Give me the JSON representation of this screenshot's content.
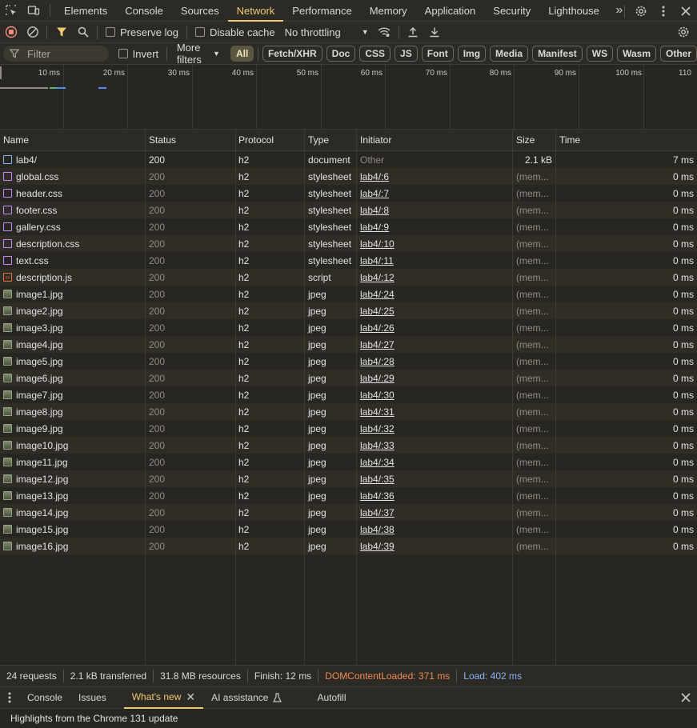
{
  "main_tabs": [
    "Elements",
    "Console",
    "Sources",
    "Network",
    "Performance",
    "Memory",
    "Application",
    "Security",
    "Lighthouse"
  ],
  "active_tab": "Network",
  "toolbar": {
    "preserve_log": "Preserve log",
    "disable_cache": "Disable cache",
    "throttling": "No throttling"
  },
  "filter": {
    "placeholder": "Filter",
    "invert": "Invert",
    "more_filters": "More filters",
    "chips": [
      "All",
      "Fetch/XHR",
      "Doc",
      "CSS",
      "JS",
      "Font",
      "Img",
      "Media",
      "Manifest",
      "WS",
      "Wasm",
      "Other"
    ],
    "active_chip": "All"
  },
  "overview": {
    "ticks": [
      "10 ms",
      "20 ms",
      "30 ms",
      "40 ms",
      "50 ms",
      "60 ms",
      "70 ms",
      "80 ms",
      "90 ms",
      "100 ms",
      "110"
    ]
  },
  "columns": [
    "Name",
    "Status",
    "Protocol",
    "Type",
    "Initiator",
    "Size",
    "Time"
  ],
  "rows": [
    {
      "name": "lab4/",
      "icon": "doc",
      "status": "200",
      "protocol": "h2",
      "type": "document",
      "initiator": "Other",
      "size": "2.1 kB",
      "time": "7 ms"
    },
    {
      "name": "global.css",
      "icon": "css",
      "status": "200",
      "protocol": "h2",
      "type": "stylesheet",
      "initiator": "lab4/:6",
      "size": "(mem...",
      "time": "0 ms"
    },
    {
      "name": "header.css",
      "icon": "css",
      "status": "200",
      "protocol": "h2",
      "type": "stylesheet",
      "initiator": "lab4/:7",
      "size": "(mem...",
      "time": "0 ms"
    },
    {
      "name": "footer.css",
      "icon": "css",
      "status": "200",
      "protocol": "h2",
      "type": "stylesheet",
      "initiator": "lab4/:8",
      "size": "(mem...",
      "time": "0 ms"
    },
    {
      "name": "gallery.css",
      "icon": "css",
      "status": "200",
      "protocol": "h2",
      "type": "stylesheet",
      "initiator": "lab4/:9",
      "size": "(mem...",
      "time": "0 ms"
    },
    {
      "name": "description.css",
      "icon": "css",
      "status": "200",
      "protocol": "h2",
      "type": "stylesheet",
      "initiator": "lab4/:10",
      "size": "(mem...",
      "time": "0 ms"
    },
    {
      "name": "text.css",
      "icon": "css",
      "status": "200",
      "protocol": "h2",
      "type": "stylesheet",
      "initiator": "lab4/:11",
      "size": "(mem...",
      "time": "0 ms"
    },
    {
      "name": "description.js",
      "icon": "js",
      "status": "200",
      "protocol": "h2",
      "type": "script",
      "initiator": "lab4/:12",
      "size": "(mem...",
      "time": "0 ms"
    },
    {
      "name": "image1.jpg",
      "icon": "img",
      "status": "200",
      "protocol": "h2",
      "type": "jpeg",
      "initiator": "lab4/:24",
      "size": "(mem...",
      "time": "0 ms"
    },
    {
      "name": "image2.jpg",
      "icon": "img",
      "status": "200",
      "protocol": "h2",
      "type": "jpeg",
      "initiator": "lab4/:25",
      "size": "(mem...",
      "time": "0 ms"
    },
    {
      "name": "image3.jpg",
      "icon": "img",
      "status": "200",
      "protocol": "h2",
      "type": "jpeg",
      "initiator": "lab4/:26",
      "size": "(mem...",
      "time": "0 ms"
    },
    {
      "name": "image4.jpg",
      "icon": "img",
      "status": "200",
      "protocol": "h2",
      "type": "jpeg",
      "initiator": "lab4/:27",
      "size": "(mem...",
      "time": "0 ms"
    },
    {
      "name": "image5.jpg",
      "icon": "img",
      "status": "200",
      "protocol": "h2",
      "type": "jpeg",
      "initiator": "lab4/:28",
      "size": "(mem...",
      "time": "0 ms"
    },
    {
      "name": "image6.jpg",
      "icon": "img",
      "status": "200",
      "protocol": "h2",
      "type": "jpeg",
      "initiator": "lab4/:29",
      "size": "(mem...",
      "time": "0 ms"
    },
    {
      "name": "image7.jpg",
      "icon": "img",
      "status": "200",
      "protocol": "h2",
      "type": "jpeg",
      "initiator": "lab4/:30",
      "size": "(mem...",
      "time": "0 ms"
    },
    {
      "name": "image8.jpg",
      "icon": "img",
      "status": "200",
      "protocol": "h2",
      "type": "jpeg",
      "initiator": "lab4/:31",
      "size": "(mem...",
      "time": "0 ms"
    },
    {
      "name": "image9.jpg",
      "icon": "img",
      "status": "200",
      "protocol": "h2",
      "type": "jpeg",
      "initiator": "lab4/:32",
      "size": "(mem...",
      "time": "0 ms"
    },
    {
      "name": "image10.jpg",
      "icon": "img",
      "status": "200",
      "protocol": "h2",
      "type": "jpeg",
      "initiator": "lab4/:33",
      "size": "(mem...",
      "time": "0 ms"
    },
    {
      "name": "image11.jpg",
      "icon": "img",
      "status": "200",
      "protocol": "h2",
      "type": "jpeg",
      "initiator": "lab4/:34",
      "size": "(mem...",
      "time": "0 ms"
    },
    {
      "name": "image12.jpg",
      "icon": "img",
      "status": "200",
      "protocol": "h2",
      "type": "jpeg",
      "initiator": "lab4/:35",
      "size": "(mem...",
      "time": "0 ms"
    },
    {
      "name": "image13.jpg",
      "icon": "img",
      "status": "200",
      "protocol": "h2",
      "type": "jpeg",
      "initiator": "lab4/:36",
      "size": "(mem...",
      "time": "0 ms"
    },
    {
      "name": "image14.jpg",
      "icon": "img",
      "status": "200",
      "protocol": "h2",
      "type": "jpeg",
      "initiator": "lab4/:37",
      "size": "(mem...",
      "time": "0 ms"
    },
    {
      "name": "image15.jpg",
      "icon": "img",
      "status": "200",
      "protocol": "h2",
      "type": "jpeg",
      "initiator": "lab4/:38",
      "size": "(mem...",
      "time": "0 ms"
    },
    {
      "name": "image16.jpg",
      "icon": "img",
      "status": "200",
      "protocol": "h2",
      "type": "jpeg",
      "initiator": "lab4/:39",
      "size": "(mem...",
      "time": "0 ms"
    }
  ],
  "summary": {
    "requests": "24 requests",
    "transferred": "2.1 kB transferred",
    "resources": "31.8 MB resources",
    "finish": "Finish: 12 ms",
    "dcl": "DOMContentLoaded: 371 ms",
    "load": "Load: 402 ms"
  },
  "colors": {
    "active_tab": "#f0c873",
    "dcl": "#f28b54",
    "load": "#8ab4f8"
  },
  "drawer": {
    "tabs": [
      "Console",
      "Issues",
      "What's new",
      "AI assistance",
      "Autofill"
    ],
    "active_tab": "What's new",
    "body": "Highlights from the Chrome 131 update"
  }
}
